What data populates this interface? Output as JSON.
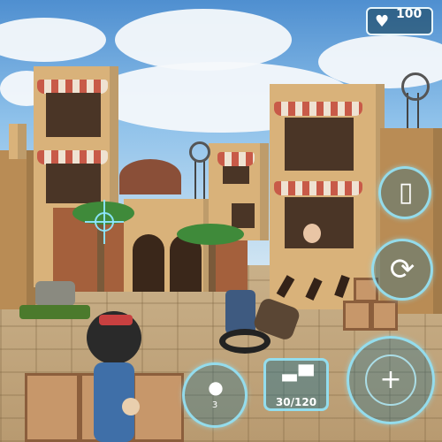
{
  "hud": {
    "health_value": "100",
    "ammo_text": "30/120",
    "grenade_count": "3"
  },
  "icons": {
    "health": "heart-icon",
    "radio": "walkie-talkie-icon",
    "reload": "reload-icon",
    "fire": "crosshair-fire-icon",
    "weapon": "smg-icon",
    "grenade": "grenade-icon",
    "aim": "aim-reticle-icon"
  },
  "colors": {
    "hud_accent": "#96e6fa",
    "hud_fill": "#1e6e8c"
  }
}
